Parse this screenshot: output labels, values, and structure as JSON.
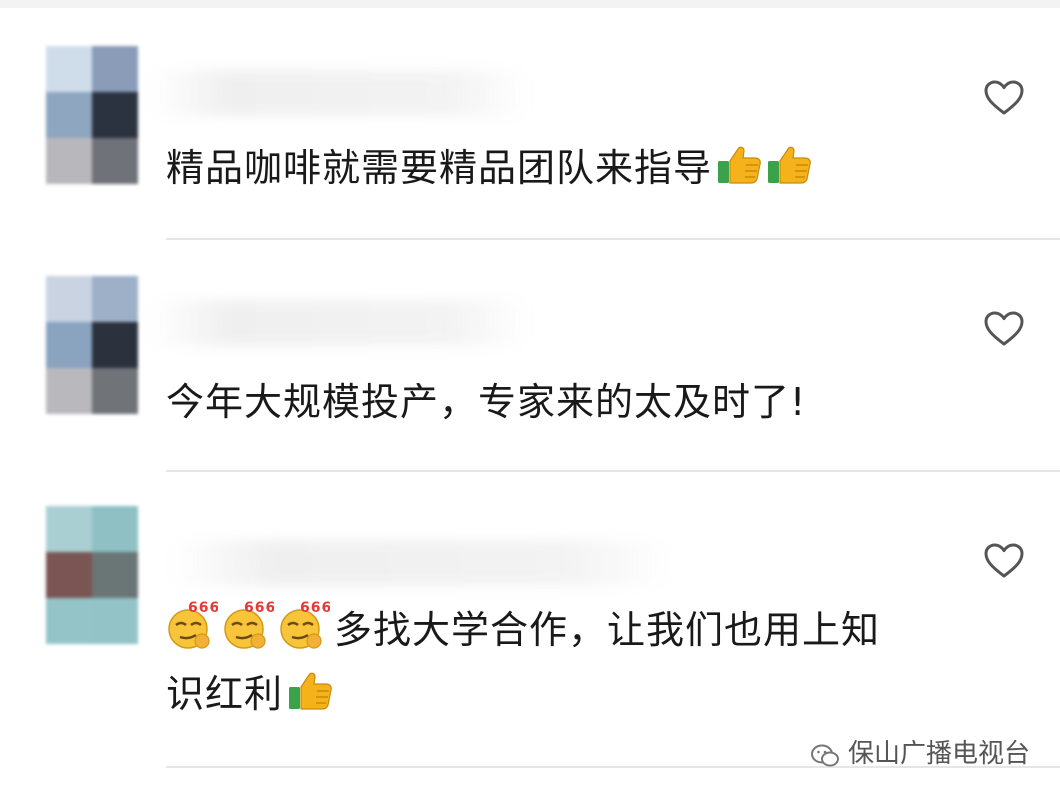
{
  "colors": {
    "text": "#191919",
    "divider": "#e6e6e6",
    "heart_outline": "#555555",
    "thumb_yellow": "#f5b21b",
    "thumb_cuff": "#3aa24a"
  },
  "comments": [
    {
      "avatar_icon": "blurred-avatar",
      "heart_icon": "heart-outline-icon",
      "text": "精品咖啡就需要精品团队来指导",
      "trailing_emojis": [
        "thumbs-up-icon",
        "thumbs-up-icon"
      ]
    },
    {
      "avatar_icon": "blurred-avatar",
      "heart_icon": "heart-outline-icon",
      "text": "今年大规模投产，专家来的太及时了!",
      "trailing_emojis": []
    },
    {
      "avatar_icon": "blurred-avatar",
      "heart_icon": "heart-outline-icon",
      "leading_emojis": [
        "smirk-666-icon",
        "smirk-666-icon",
        "smirk-666-icon"
      ],
      "emoji_label": "666",
      "text_line1": "多找大学合作，让我们也用上知",
      "text_line2": "识红利",
      "trailing_emojis": [
        "thumbs-up-icon"
      ]
    }
  ],
  "watermark": {
    "icon": "wechat-icon",
    "label": "保山广播电视台"
  }
}
